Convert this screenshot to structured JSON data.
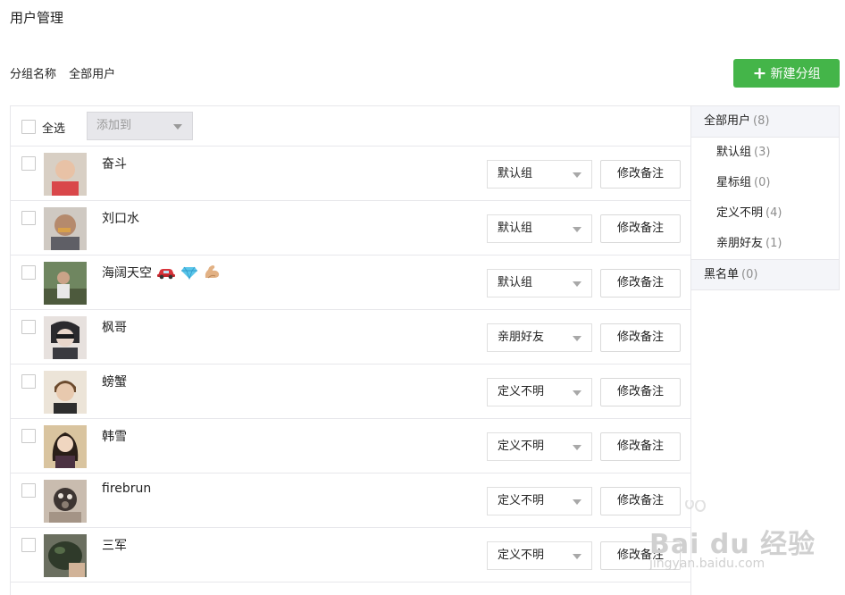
{
  "page": {
    "title": "用户管理"
  },
  "group_bar": {
    "label": "分组名称",
    "current": "全部用户"
  },
  "new_group": {
    "plus": "+",
    "label": "新建分组"
  },
  "list_header": {
    "select_all": "全选",
    "add_to": "添加到"
  },
  "users": [
    {
      "name": "奋斗",
      "group": "默认组",
      "remark": "修改备注",
      "avatar_color": "#c9a88f",
      "emoji": ""
    },
    {
      "name": "刘口水",
      "group": "默认组",
      "remark": "修改备注",
      "avatar_color": "#7d6a5c",
      "emoji": ""
    },
    {
      "name": "海阔天空",
      "group": "默认组",
      "remark": "修改备注",
      "avatar_color": "#6b7a5a",
      "emoji": "car,diamond,muscle"
    },
    {
      "name": "枫哥",
      "group": "亲朋好友",
      "remark": "修改备注",
      "avatar_color": "#3b3a3d",
      "emoji": ""
    },
    {
      "name": "螃蟹",
      "group": "定义不明",
      "remark": "修改备注",
      "avatar_color": "#d9c5a9",
      "emoji": ""
    },
    {
      "name": "韩雪",
      "group": "定义不明",
      "remark": "修改备注",
      "avatar_color": "#b9a27f",
      "emoji": ""
    },
    {
      "name": "firebrun",
      "group": "定义不明",
      "remark": "修改备注",
      "avatar_color": "#8c8179",
      "emoji": ""
    },
    {
      "name": "三军",
      "group": "定义不明",
      "remark": "修改备注",
      "avatar_color": "#3f4a35",
      "emoji": ""
    }
  ],
  "sidebar": {
    "all": {
      "label": "全部用户",
      "count": "(8)"
    },
    "groups": [
      {
        "label": "默认组",
        "count": "(3)"
      },
      {
        "label": "星标组",
        "count": "(0)"
      },
      {
        "label": "定义不明",
        "count": "(4)"
      },
      {
        "label": "亲朋好友",
        "count": "(1)"
      }
    ],
    "blacklist": {
      "label": "黑名单",
      "count": "(0)"
    }
  },
  "watermark": {
    "brand": "Bai du 经验",
    "url": "jingyan.baidu.com"
  },
  "colors": {
    "accent": "#44b549",
    "border": "#e7e7eb",
    "muted": "#8d8d8d"
  }
}
